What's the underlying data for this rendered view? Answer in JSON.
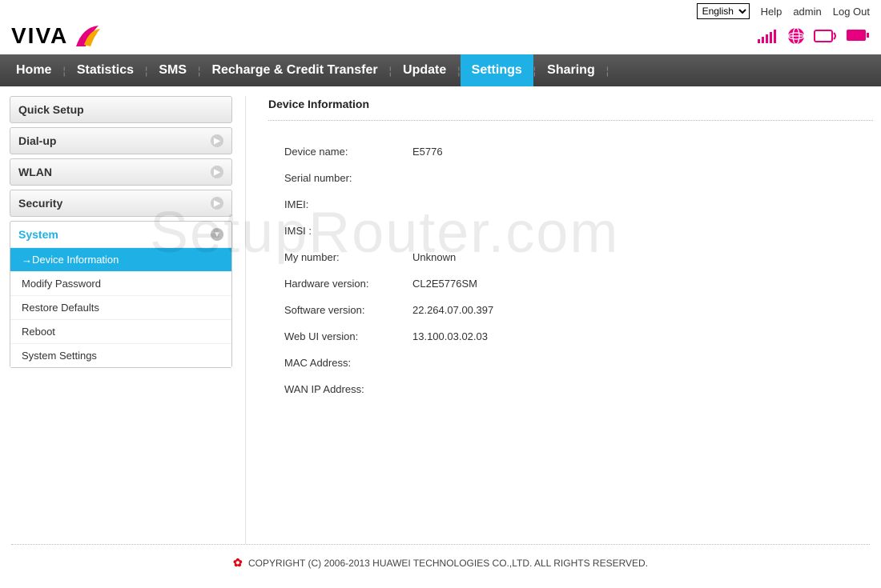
{
  "top": {
    "language": "English",
    "help": "Help",
    "user": "admin",
    "logout": "Log Out"
  },
  "brand": "VIVA",
  "nav": {
    "items": [
      "Home",
      "Statistics",
      "SMS",
      "Recharge & Credit Transfer",
      "Update",
      "Settings",
      "Sharing"
    ],
    "active_index": 5
  },
  "sidebar": {
    "quick_setup": "Quick Setup",
    "dial_up": "Dial-up",
    "wlan": "WLAN",
    "security": "Security",
    "system": "System",
    "sub": {
      "device_info": "Device Information",
      "modify_password": "Modify Password",
      "restore_defaults": "Restore Defaults",
      "reboot": "Reboot",
      "system_settings": "System Settings"
    }
  },
  "content": {
    "title": "Device Information",
    "rows": {
      "device_name_label": "Device name:",
      "device_name_value": "E5776",
      "serial_label": "Serial number:",
      "serial_value": "",
      "imei_label": "IMEI:",
      "imei_value": "",
      "imsi_label": "IMSI :",
      "imsi_value": "",
      "my_number_label": "My number:",
      "my_number_value": "Unknown",
      "hw_label": "Hardware version:",
      "hw_value": "CL2E5776SM",
      "sw_label": "Software version:",
      "sw_value": "22.264.07.00.397",
      "webui_label": "Web UI version:",
      "webui_value": "13.100.03.02.03",
      "mac_label": "MAC Address:",
      "mac_value": "",
      "wanip_label": "WAN IP Address:",
      "wanip_value": ""
    }
  },
  "footer": "COPYRIGHT (C) 2006-2013 HUAWEI TECHNOLOGIES CO.,LTD. ALL RIGHTS RESERVED.",
  "watermark": "SetupRouter.com"
}
